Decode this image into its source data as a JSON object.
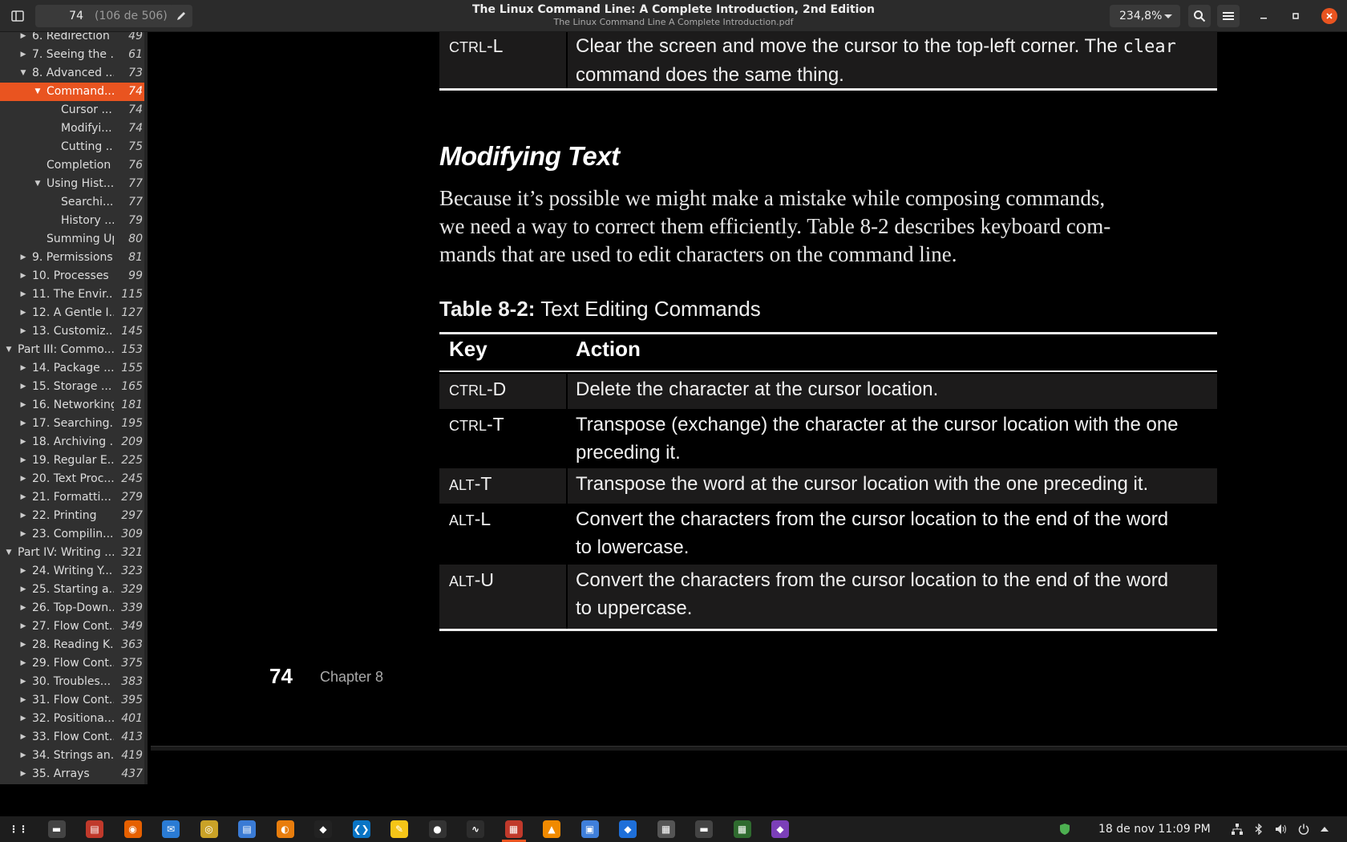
{
  "header": {
    "page_current": "74",
    "page_total": "(106 de 506)",
    "title": "The Linux Command Line: A Complete Introduction, 2nd Edition",
    "subtitle": "The Linux Command Line A Complete Introduction.pdf",
    "zoom": "234,8%"
  },
  "outline": [
    {
      "label": "6. Redirection",
      "page": "49",
      "level": 1,
      "state": "collapsed"
    },
    {
      "label": "7. Seeing the ...",
      "page": "61",
      "level": 1,
      "state": "collapsed"
    },
    {
      "label": "8. Advanced ...",
      "page": "73",
      "level": 1,
      "state": "expanded"
    },
    {
      "label": "Command...",
      "page": "74",
      "level": 2,
      "state": "expanded",
      "selected": true
    },
    {
      "label": "Cursor ...",
      "page": "74",
      "level": 3,
      "state": "none"
    },
    {
      "label": "Modifyi...",
      "page": "74",
      "level": 3,
      "state": "none"
    },
    {
      "label": "Cutting ...",
      "page": "75",
      "level": 3,
      "state": "none"
    },
    {
      "label": "Completion",
      "page": "76",
      "level": 2,
      "state": "none"
    },
    {
      "label": "Using Hist...",
      "page": "77",
      "level": 2,
      "state": "expanded"
    },
    {
      "label": "Searchi...",
      "page": "77",
      "level": 3,
      "state": "none"
    },
    {
      "label": "History ...",
      "page": "79",
      "level": 3,
      "state": "none"
    },
    {
      "label": "Summing Up",
      "page": "80",
      "level": 2,
      "state": "none"
    },
    {
      "label": "9. Permissions",
      "page": "81",
      "level": 1,
      "state": "collapsed"
    },
    {
      "label": "10. Processes",
      "page": "99",
      "level": 1,
      "state": "collapsed"
    },
    {
      "label": "11. The Envir...",
      "page": "115",
      "level": 1,
      "state": "collapsed"
    },
    {
      "label": "12. A Gentle I...",
      "page": "127",
      "level": 1,
      "state": "collapsed"
    },
    {
      "label": "13. Customiz...",
      "page": "145",
      "level": 1,
      "state": "collapsed"
    },
    {
      "label": "Part III: Commo...",
      "page": "153",
      "level": 0,
      "state": "expanded"
    },
    {
      "label": "14. Package ...",
      "page": "155",
      "level": 1,
      "state": "collapsed"
    },
    {
      "label": "15. Storage ...",
      "page": "165",
      "level": 1,
      "state": "collapsed"
    },
    {
      "label": "16. Networking",
      "page": "181",
      "level": 1,
      "state": "collapsed"
    },
    {
      "label": "17. Searching...",
      "page": "195",
      "level": 1,
      "state": "collapsed"
    },
    {
      "label": "18. Archiving ...",
      "page": "209",
      "level": 1,
      "state": "collapsed"
    },
    {
      "label": "19. Regular E...",
      "page": "225",
      "level": 1,
      "state": "collapsed"
    },
    {
      "label": "20. Text Proc...",
      "page": "245",
      "level": 1,
      "state": "collapsed"
    },
    {
      "label": "21. Formatti...",
      "page": "279",
      "level": 1,
      "state": "collapsed"
    },
    {
      "label": "22. Printing",
      "page": "297",
      "level": 1,
      "state": "collapsed"
    },
    {
      "label": "23. Compilin...",
      "page": "309",
      "level": 1,
      "state": "collapsed"
    },
    {
      "label": "Part IV: Writing ...",
      "page": "321",
      "level": 0,
      "state": "expanded"
    },
    {
      "label": "24. Writing Y...",
      "page": "323",
      "level": 1,
      "state": "collapsed"
    },
    {
      "label": "25. Starting a...",
      "page": "329",
      "level": 1,
      "state": "collapsed"
    },
    {
      "label": "26. Top-Down...",
      "page": "339",
      "level": 1,
      "state": "collapsed"
    },
    {
      "label": "27. Flow Cont...",
      "page": "349",
      "level": 1,
      "state": "collapsed"
    },
    {
      "label": "28. Reading K...",
      "page": "363",
      "level": 1,
      "state": "collapsed"
    },
    {
      "label": "29. Flow Cont...",
      "page": "375",
      "level": 1,
      "state": "collapsed"
    },
    {
      "label": "30. Troubles...",
      "page": "383",
      "level": 1,
      "state": "collapsed"
    },
    {
      "label": "31. Flow Cont...",
      "page": "395",
      "level": 1,
      "state": "collapsed"
    },
    {
      "label": "32. Positiona...",
      "page": "401",
      "level": 1,
      "state": "collapsed"
    },
    {
      "label": "33. Flow Cont...",
      "page": "413",
      "level": 1,
      "state": "collapsed"
    },
    {
      "label": "34. Strings an...",
      "page": "419",
      "level": 1,
      "state": "collapsed"
    },
    {
      "label": "35. Arrays",
      "page": "437",
      "level": 1,
      "state": "collapsed"
    }
  ],
  "doc": {
    "prev_row": {
      "key_mod": "CTRL",
      "key_suffix": "-L",
      "action_line1_pre": "Clear the screen and move the cursor to the top-left corner. The ",
      "action_code": "clear",
      "action_line2": "command does the same thing."
    },
    "heading": "Modifying Text",
    "body_lines": [
      "Because it’s possible we might make a mistake while composing commands,",
      "we need a way to correct them efficiently. Table 8-2 describes keyboard com-",
      "mands that are used to edit characters on the command line."
    ],
    "table_caption_label": "Table 8-2:",
    "table_caption_text": " Text Editing Commands",
    "col_key": "Key",
    "col_action": "Action",
    "rows": [
      {
        "mod": "CTRL",
        "suffix": "-D",
        "line1": "Delete the character at the cursor location.",
        "line2": ""
      },
      {
        "mod": "CTRL",
        "suffix": "-T",
        "line1": "Transpose (exchange) the character at the cursor location with the one",
        "line2": "preceding it."
      },
      {
        "mod": "ALT",
        "suffix": "-T",
        "line1": "Transpose the word at the cursor location with the one preceding it.",
        "line2": ""
      },
      {
        "mod": "ALT",
        "suffix": "-L",
        "line1": "Convert the characters from the cursor location to the end of the word",
        "line2": "to lowercase."
      },
      {
        "mod": "ALT",
        "suffix": "-U",
        "line1": "Convert the characters from the cursor location to the end of the word",
        "line2": "to uppercase."
      }
    ],
    "footer_page": "74",
    "footer_chapter": "Chapter 8"
  },
  "taskbar": {
    "clock": "18 de nov  11:09 PM",
    "apps": [
      "app-grid-icon",
      "files-icon",
      "document-viewer-icon",
      "firefox-icon",
      "thunderbird-icon",
      "rhythmbox-icon",
      "text-editor-icon",
      "blender-icon",
      "inkscape-icon",
      "vscode-icon",
      "notes-icon",
      "obs-icon",
      "system-monitor-icon",
      "pdf-reader-icon",
      "vlc-icon",
      "screenshot-icon",
      "diagram-icon",
      "archive-icon",
      "terminal-icon",
      "calculator-icon",
      "brave-icon"
    ]
  },
  "colors": {
    "accent": "#e95420",
    "header_bg": "#2b2b2b",
    "sidebar_bg": "#303030",
    "table_shade": "#1c1b1b"
  }
}
